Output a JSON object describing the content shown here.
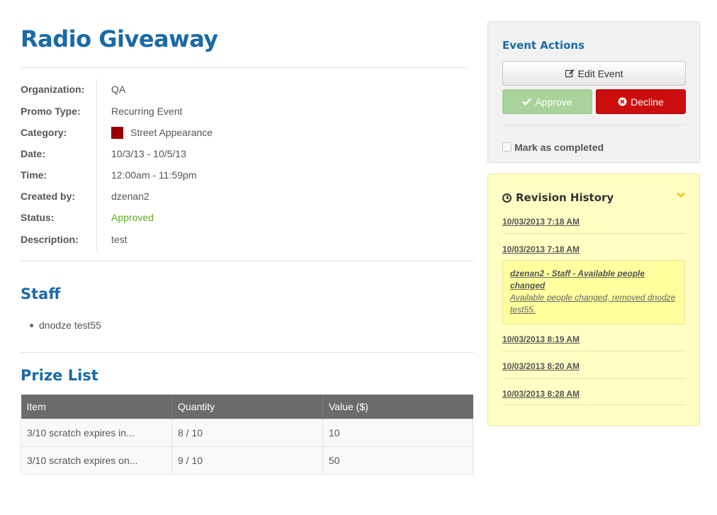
{
  "page": {
    "title": "Radio Giveaway"
  },
  "details": [
    {
      "label": "Organization:",
      "value": "QA"
    },
    {
      "label": "Promo Type:",
      "value": "Recurring Event"
    },
    {
      "label": "Category:",
      "value": "Street Appearance",
      "swatch_color": "#990000"
    },
    {
      "label": "Date:",
      "value": "10/3/13 - 10/5/13"
    },
    {
      "label": "Time:",
      "value": "12:00am - 11:59pm"
    },
    {
      "label": "Created by:",
      "value": "dzenan2"
    },
    {
      "label": "Status:",
      "value": "Approved",
      "color": "#5cad1f"
    },
    {
      "label": "Description:",
      "value": "test"
    }
  ],
  "staff": {
    "title": "Staff",
    "items": [
      "dnodze test55"
    ]
  },
  "prizes": {
    "title": "Prize List",
    "columns": [
      "Item",
      "Quantity",
      "Value ($)"
    ],
    "rows": [
      [
        "3/10 scratch expires in...",
        "8 / 10",
        "10"
      ],
      [
        "3/10 scratch expires on...",
        "9 / 10",
        "50"
      ]
    ]
  },
  "actions": {
    "title": "Event Actions",
    "edit_label": "Edit Event",
    "approve_label": "Approve",
    "decline_label": "Decline",
    "mark_completed_label": "Mark as completed"
  },
  "revisions": {
    "title": "Revision History",
    "entries": [
      "10/03/2013 7:18 AM",
      "10/03/2013 7:18 AM",
      "10/03/2013 8:19 AM",
      "10/03/2013 8:20 AM",
      "10/03/2013 8:28 AM"
    ],
    "detail": {
      "title": "dzenan2 - Staff - Available people changed",
      "body": "Available people changed, removed dnodze test55."
    }
  },
  "colors": {
    "heading": "#1a6aa8",
    "status_approved": "#5cad1f",
    "decline": "#cc0d0d",
    "approve": "#a9d39a",
    "revision_bg": "#ffffc4"
  }
}
